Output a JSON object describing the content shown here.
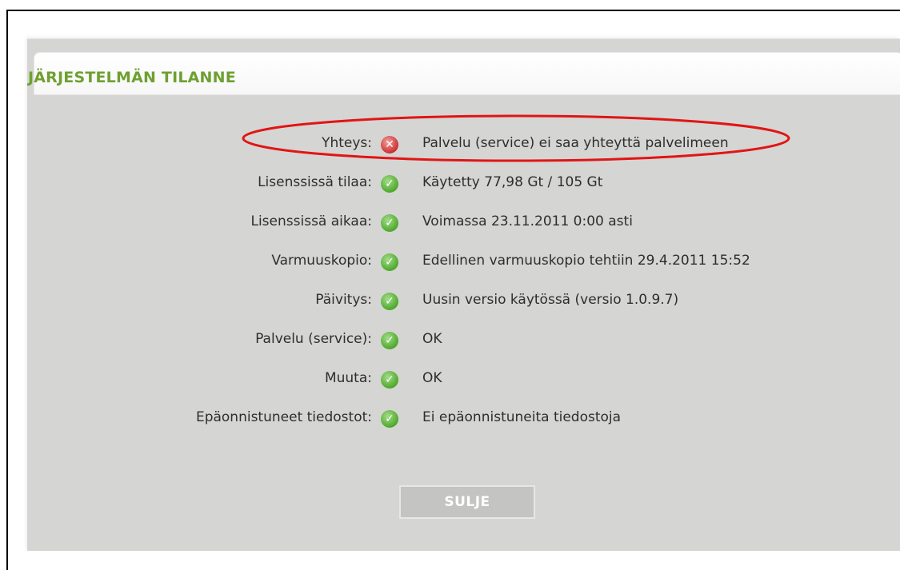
{
  "dialog": {
    "title": "JÄRJESTELMÄN TILANNE",
    "close_label": "SULJE"
  },
  "status_rows": [
    {
      "label": "Yhteys:",
      "status": "error",
      "icon": "error-x-icon",
      "value": "Palvelu (service) ei saa yhteyttä palvelimeen"
    },
    {
      "label": "Lisenssissä tilaa:",
      "status": "ok",
      "icon": "check-icon",
      "value": "Käytetty 77,98 Gt / 105 Gt"
    },
    {
      "label": "Lisenssissä aikaa:",
      "status": "ok",
      "icon": "check-icon",
      "value": "Voimassa 23.11.2011 0:00 asti"
    },
    {
      "label": "Varmuuskopio:",
      "status": "ok",
      "icon": "check-icon",
      "value": "Edellinen varmuuskopio tehtiin 29.4.2011 15:52"
    },
    {
      "label": "Päivitys:",
      "status": "ok",
      "icon": "check-icon",
      "value": "Uusin versio käytössä (versio 1.0.9.7)"
    },
    {
      "label": "Palvelu (service):",
      "status": "ok",
      "icon": "check-icon",
      "value": "OK"
    },
    {
      "label": "Muuta:",
      "status": "ok",
      "icon": "check-icon",
      "value": "OK"
    },
    {
      "label": "Epäonnistuneet tiedostot:",
      "status": "ok",
      "icon": "check-icon",
      "value": "Ei epäonnistuneita tiedostoja"
    }
  ],
  "colors": {
    "title_green": "#6ea030",
    "dialog_bg": "#d5d5d3",
    "highlight_red": "#e01515",
    "ok_green": "#4ea82c",
    "error_red": "#cc3030"
  }
}
